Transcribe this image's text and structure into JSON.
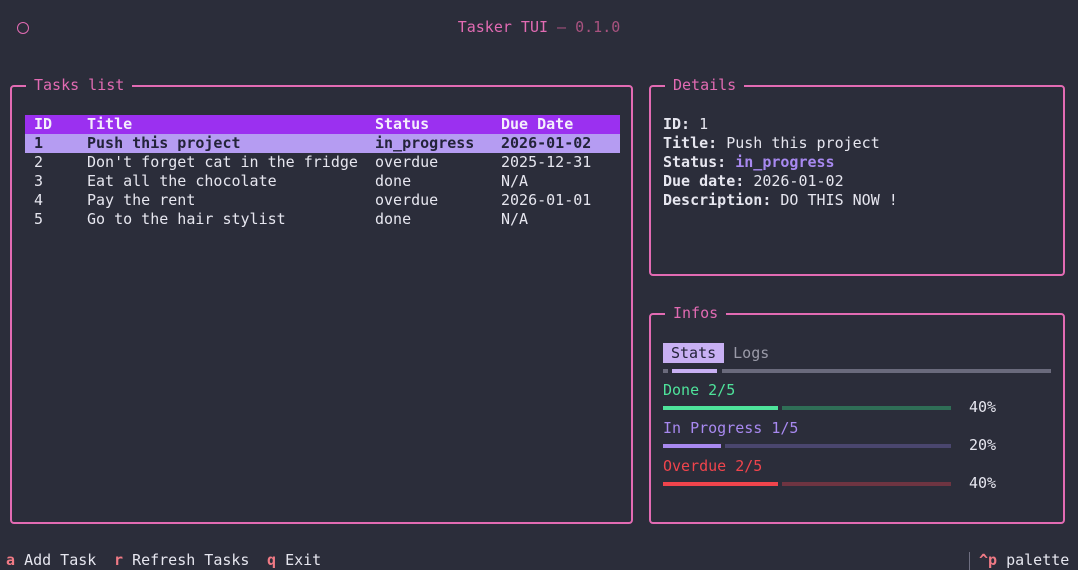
{
  "app": {
    "title": "Tasker TUI",
    "separator": " — ",
    "version": "0.1.0"
  },
  "tasks_panel": {
    "title": "Tasks list",
    "columns": [
      "ID",
      "Title",
      "Status",
      "Due Date"
    ],
    "rows": [
      {
        "id": "1",
        "title": "Push this project",
        "status": "in_progress",
        "due": "2026-01-02"
      },
      {
        "id": "2",
        "title": "Don't forget cat in the fridge",
        "status": "overdue",
        "due": "2025-12-31"
      },
      {
        "id": "3",
        "title": "Eat all the chocolate",
        "status": "done",
        "due": "N/A"
      },
      {
        "id": "4",
        "title": "Pay the rent",
        "status": "overdue",
        "due": "2026-01-01"
      },
      {
        "id": "5",
        "title": "Go to the hair stylist",
        "status": "done",
        "due": "N/A"
      }
    ],
    "selected_row": 0
  },
  "details_panel": {
    "title": "Details",
    "fields": {
      "id_label": "ID:",
      "id_value": "1",
      "title_label": "Title:",
      "title_value": "Push this project",
      "status_label": "Status:",
      "status_value": "in_progress",
      "due_label": "Due date:",
      "due_value": "2026-01-02",
      "description_label": "Description:",
      "description_value": "DO THIS NOW !"
    }
  },
  "infos_panel": {
    "title": "Infos",
    "tabs": [
      "Stats",
      "Logs"
    ],
    "active_tab": 0,
    "stats": [
      {
        "label": "Done 2/5",
        "percent_text": "40%",
        "fraction": 0.4,
        "color": "#4ee39b",
        "track_color": "#2f6e56"
      },
      {
        "label": "In Progress 1/5",
        "percent_text": "20%",
        "fraction": 0.2,
        "color": "#a889f0",
        "track_color": "#4a466e"
      },
      {
        "label": "Overdue 2/5",
        "percent_text": "40%",
        "fraction": 0.4,
        "color": "#f0444c",
        "track_color": "#6e3441"
      }
    ]
  },
  "footer": {
    "bindings": [
      {
        "key": "a",
        "label": "Add Task"
      },
      {
        "key": "r",
        "label": "Refresh Tasks"
      },
      {
        "key": "q",
        "label": "Exit"
      }
    ],
    "palette": {
      "key": "^p",
      "label": "palette"
    }
  },
  "colors": {
    "background": "#2b2d3a",
    "accent": "#e26bb3",
    "header_row": "#9b30f0",
    "selected_row": "#b59cf2"
  }
}
